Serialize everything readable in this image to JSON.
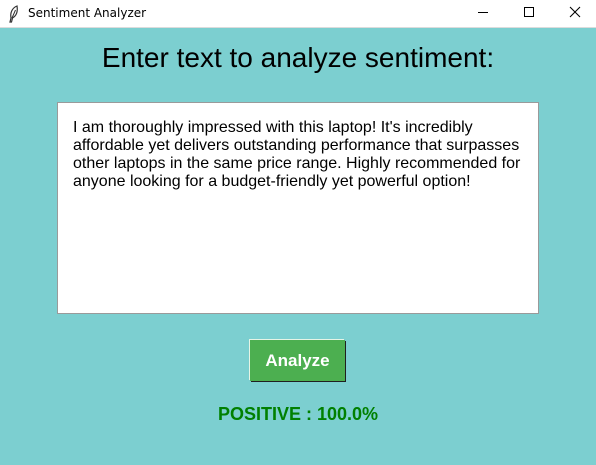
{
  "window": {
    "title": "Sentiment Analyzer",
    "icons": {
      "app": "feather-icon",
      "minimize": "minimize-icon",
      "maximize": "maximize-icon",
      "close": "close-icon"
    }
  },
  "main": {
    "heading": "Enter text to analyze sentiment:",
    "input_text": "I am thoroughly impressed with this laptop! It's incredibly affordable yet delivers outstanding performance that surpasses other laptops in the same price range. Highly recommended for anyone looking for a budget-friendly yet powerful option!",
    "analyze_label": "Analyze",
    "result_text": "POSITIVE : 100.0%",
    "result_color": "#008000"
  },
  "colors": {
    "background": "#7ccfd0",
    "button": "#4caf50"
  }
}
